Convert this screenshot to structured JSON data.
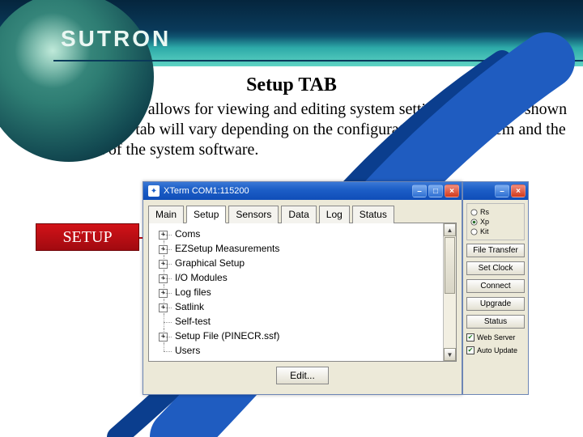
{
  "brand": "SUTRON",
  "headline": "Setup TAB",
  "body_text": "The setup tab allows for viewing and editing system settings. The items shown in the setup tab will vary depending on the configuration of the system and the version of the system software.",
  "callout": "SETUP",
  "window": {
    "title": "XTerm COM1:115200",
    "tabs": [
      "Main",
      "Setup",
      "Sensors",
      "Data",
      "Log",
      "Status"
    ],
    "active_tab_index": 1,
    "tree": [
      {
        "label": "Coms",
        "expandable": true
      },
      {
        "label": "EZSetup Measurements",
        "expandable": true
      },
      {
        "label": "Graphical Setup",
        "expandable": true
      },
      {
        "label": "I/O Modules",
        "expandable": true
      },
      {
        "label": "Log files",
        "expandable": true
      },
      {
        "label": "Satlink",
        "expandable": true
      },
      {
        "label": "Self-test",
        "expandable": false
      },
      {
        "label": "Setup File (PINECR.ssf)",
        "expandable": true
      },
      {
        "label": "Users",
        "expandable": false
      }
    ],
    "edit_button": "Edit..."
  },
  "rpanel": {
    "radios1": [
      {
        "label": "Rs",
        "checked": false
      },
      {
        "label": "Xp",
        "checked": true
      },
      {
        "label": "Kit",
        "checked": false
      }
    ],
    "buttons": [
      "File Transfer",
      "Set Clock",
      "Connect",
      "Upgrade",
      "Status"
    ],
    "checks": [
      {
        "label": "Web Server",
        "checked": true
      },
      {
        "label": "Auto Update",
        "checked": true
      }
    ]
  }
}
